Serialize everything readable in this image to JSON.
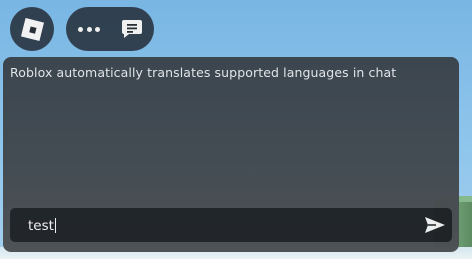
{
  "top_bar": {
    "menu_button_icon": "roblox-logo-icon",
    "more_icon": "more-horizontal-icon",
    "chat_icon": "chat-bubble-icon"
  },
  "chat": {
    "system_message": "Roblox automatically translates supported languages in chat",
    "input": {
      "value": "test"
    },
    "send_icon": "send-icon"
  },
  "colors": {
    "panel": "#3f474d",
    "input_bar": "#1e2124",
    "text": "#e4e6e8",
    "button_bg": "#1b1f26",
    "sky": "#8ec5ec"
  }
}
